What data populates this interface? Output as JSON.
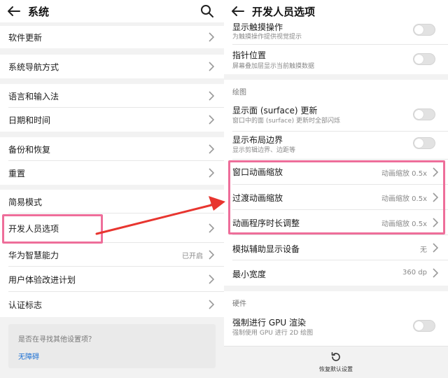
{
  "left": {
    "title": "系统",
    "back_icon": "back-arrow-icon",
    "search_icon": "search-icon",
    "items": [
      {
        "label": "软件更新"
      },
      {
        "label": "系统导航方式"
      },
      {
        "label": "语言和输入法"
      },
      {
        "label": "日期和时间"
      },
      {
        "label": "备份和恢复"
      },
      {
        "label": "重置"
      },
      {
        "label": "简易模式"
      },
      {
        "label": "开发人员选项"
      },
      {
        "label": "华为智慧能力",
        "value": "已开启"
      },
      {
        "label": "用户体验改进计划"
      },
      {
        "label": "认证标志"
      }
    ],
    "help_card": {
      "question": "是否在寻找其他设置项？",
      "link": "无障碍"
    }
  },
  "right": {
    "title": "开发人员选项",
    "back_icon": "back-arrow-icon",
    "rows": [
      {
        "label": "显示触摸操作",
        "sub": "为触摸操作提供视觉提示",
        "toggle": false
      },
      {
        "label": "指针位置",
        "sub": "屏幕叠加层显示当前触摸数据",
        "toggle": false
      }
    ],
    "section_drawing": "绘图",
    "drawing_rows": [
      {
        "label": "显示面 (surface) 更新",
        "sub": "窗口中的面 (surface) 更新时全部闪烁",
        "toggle": false
      },
      {
        "label": "显示布局边界",
        "sub": "显示剪辑边界、边距等",
        "toggle": false
      }
    ],
    "animation_rows": [
      {
        "label": "窗口动画缩放",
        "value": "动画缩放 0.5x"
      },
      {
        "label": "过渡动画缩放",
        "value": "动画缩放 0.5x"
      },
      {
        "label": "动画程序时长调整",
        "value": "动画缩放 0.5x"
      }
    ],
    "more_rows": [
      {
        "label": "模拟辅助显示设备",
        "value": "无"
      },
      {
        "label": "最小宽度",
        "value": "360 dp"
      }
    ],
    "section_hardware": "硬件",
    "hardware_rows": [
      {
        "label": "强制进行 GPU 渲染",
        "sub": "强制使用 GPU 进行 2D 绘图",
        "toggle": false
      }
    ],
    "footer": {
      "label": "恢复默认设置",
      "icon": "reset-icon"
    }
  },
  "colors": {
    "highlight": "#ee6e9a",
    "arrow": "#e8352f",
    "link": "#1b6fd3"
  }
}
